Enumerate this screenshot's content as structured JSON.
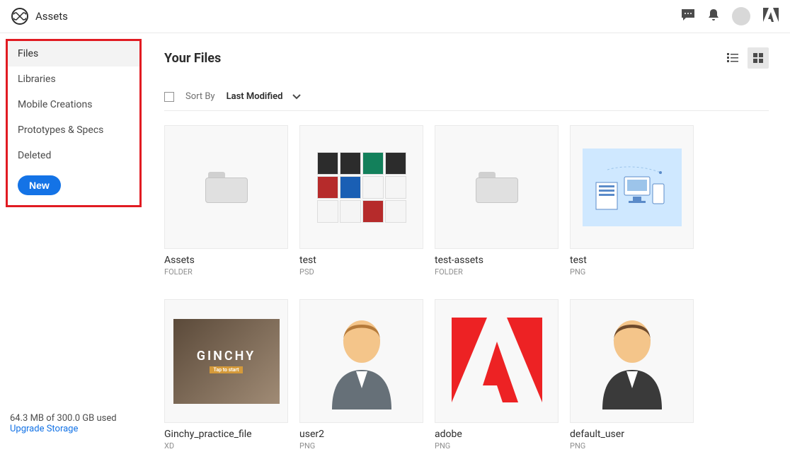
{
  "header": {
    "title": "Assets",
    "cc_symbol": "∞"
  },
  "sidebar": {
    "items": [
      {
        "label": "Files",
        "active": true
      },
      {
        "label": "Libraries",
        "active": false
      },
      {
        "label": "Mobile Creations",
        "active": false
      },
      {
        "label": "Prototypes & Specs",
        "active": false
      },
      {
        "label": "Deleted",
        "active": false
      }
    ],
    "new_button": "New",
    "storage_text": "64.3 MB of 300.0 GB used",
    "upgrade_link": "Upgrade Storage"
  },
  "main": {
    "page_title": "Your Files",
    "sort_label": "Sort By",
    "sort_value": "Last Modified",
    "files": [
      {
        "name": "Assets",
        "type": "FOLDER",
        "thumbKind": "folder"
      },
      {
        "name": "test",
        "type": "PSD",
        "thumbKind": "psd"
      },
      {
        "name": "test-assets",
        "type": "FOLDER",
        "thumbKind": "folder"
      },
      {
        "name": "test",
        "type": "PNG",
        "thumbKind": "illustration"
      },
      {
        "name": "Ginchy_practice_file",
        "type": "XD",
        "thumbKind": "ginchy",
        "thumbText": "GINCHY"
      },
      {
        "name": "user2",
        "type": "PNG",
        "thumbKind": "user-light"
      },
      {
        "name": "adobe",
        "type": "PNG",
        "thumbKind": "adobe"
      },
      {
        "name": "default_user",
        "type": "PNG",
        "thumbKind": "user-dark"
      }
    ]
  }
}
